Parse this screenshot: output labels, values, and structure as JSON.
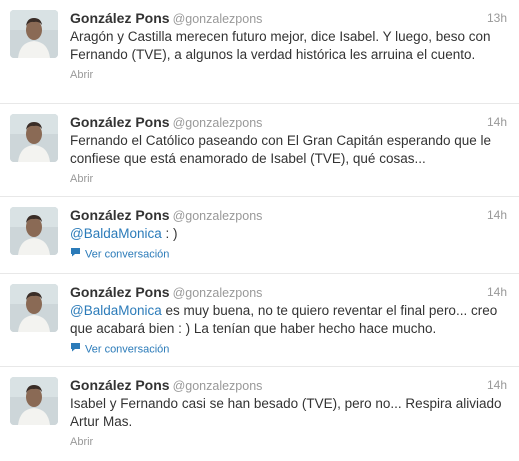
{
  "tweets": [
    {
      "name": "González Pons",
      "handle": "@gonzalezpons",
      "time": "13h",
      "text": "Aragón y Castilla merecen futuro mejor, dice Isabel. Y luego, beso con Fernando (TVE), a algunos la verdad histórica les arruina el cuento.",
      "action": "Abrir"
    },
    {
      "name": "González Pons",
      "handle": "@gonzalezpons",
      "time": "14h",
      "text": "Fernando el Católico paseando con El Gran Capitán esperando que le confiese que está enamorado de Isabel (TVE), qué cosas...",
      "action": "Abrir"
    },
    {
      "name": "González Pons",
      "handle": "@gonzalezpons",
      "time": "14h",
      "mention": "@BaldaMonica",
      "text_after": " : )",
      "action": "Ver conversación"
    },
    {
      "name": "González Pons",
      "handle": "@gonzalezpons",
      "time": "14h",
      "mention": "@BaldaMonica",
      "text_after": " es muy buena, no te quiero reventar el final pero... creo que acabará bien : ) La tenían que haber hecho hace mucho.",
      "action": "Ver conversación"
    },
    {
      "name": "González Pons",
      "handle": "@gonzalezpons",
      "time": "14h",
      "text": "Isabel y Fernando casi se han besado (TVE), pero no... Respira aliviado Artur Mas.",
      "action": "Abrir"
    }
  ],
  "icons": {
    "conversation": "speech-bubble-icon",
    "avatar": "profile-photo"
  },
  "colors": {
    "link": "#2b7bb9",
    "muted": "#999999",
    "text": "#333333"
  }
}
